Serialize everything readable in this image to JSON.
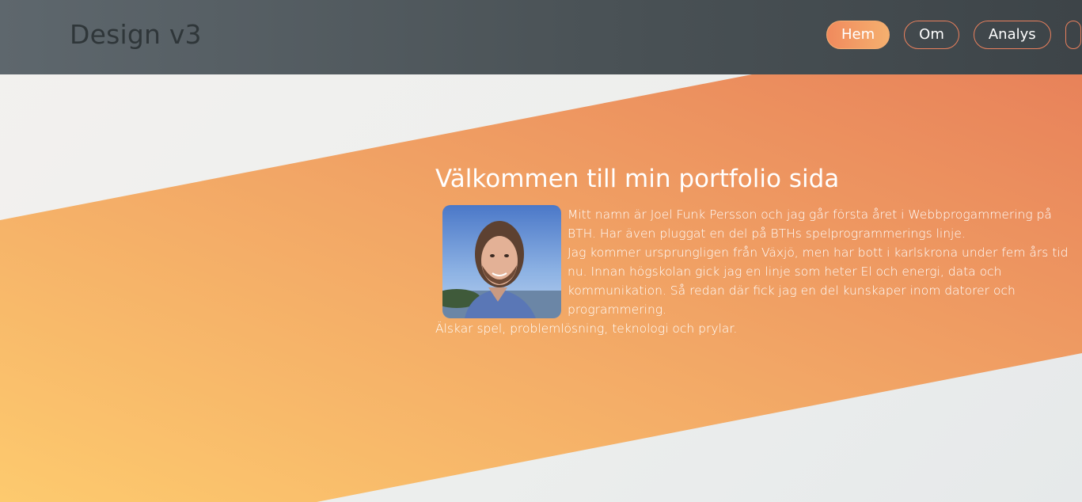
{
  "header": {
    "site_title": "Design v3",
    "nav": [
      {
        "label": "Hem",
        "active": true
      },
      {
        "label": "Om",
        "active": false
      },
      {
        "label": "Analys",
        "active": false
      },
      {
        "label": "",
        "active": false
      }
    ]
  },
  "main": {
    "heading": "Välkommen till min portfolio sida",
    "paragraphs": [
      "Mitt namn är Joel Funk Persson och jag går första året i Webbprogammering på BTH. Har även pluggat en del på BTHs spelprogrammerings linje.",
      "Jag kommer ursprungligen från Växjö, men har bott i karlskrona under fem års tid nu. Innan högskolan gick jag en linje som heter El och energi, data och kommunikation. Så redan där fick jag en del kunskaper inom datorer och programmering.",
      "Älskar spel, problemlösning, teknologi och prylar."
    ]
  },
  "colors": {
    "accent_orange": "#ee8a5c",
    "accent_yellow": "#fcc870",
    "header_dark": "#4a5256"
  }
}
